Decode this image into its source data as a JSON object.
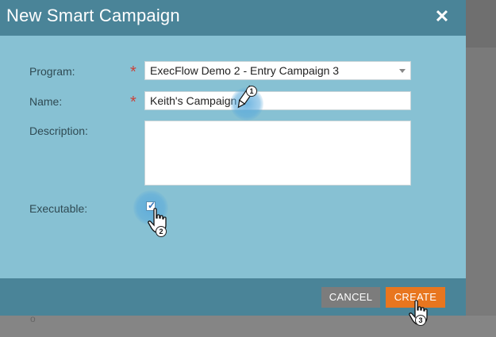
{
  "dialog": {
    "title": "New Smart Campaign",
    "close_glyph": "✕"
  },
  "form": {
    "program": {
      "label": "Program:",
      "required": "*",
      "value": "ExecFlow Demo 2 - Entry Campaign 3"
    },
    "name": {
      "label": "Name:",
      "required": "*",
      "value": "Keith's Campaign"
    },
    "description": {
      "label": "Description:",
      "value": ""
    },
    "executable": {
      "label": "Executable:",
      "checked": true,
      "tick": "✓"
    }
  },
  "footer": {
    "cancel_label": "CANCEL",
    "create_label": "CREATE"
  },
  "annotations": {
    "step1": "1",
    "step2": "2",
    "step3": "3"
  },
  "background": {
    "fragment_text": "o"
  },
  "colors": {
    "header": "#4a8498",
    "body": "#87c1d3",
    "required_star": "#c9433b",
    "create_button": "#e8761f",
    "cancel_button": "#7c7c7c"
  },
  "icons": {
    "close": "close-icon",
    "dropdown": "chevron-down-icon",
    "checkbox": "check-icon",
    "pencil_cursor": "pencil-cursor-icon",
    "hand_cursor": "hand-pointer-icon"
  }
}
